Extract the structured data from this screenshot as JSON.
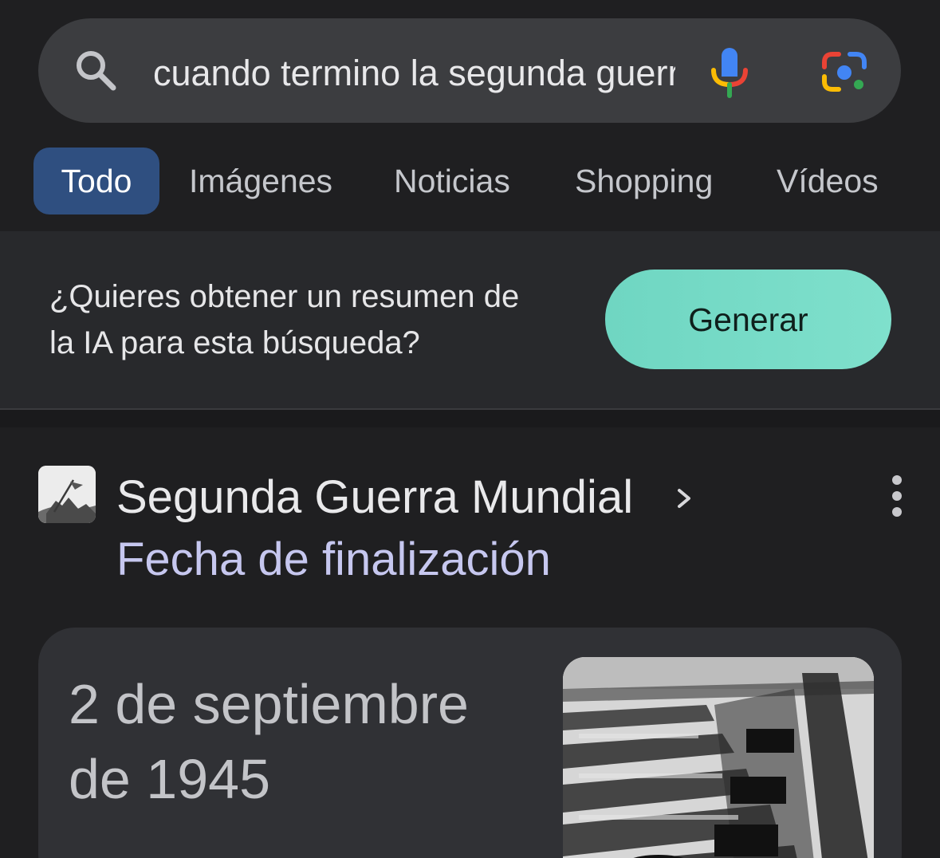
{
  "search": {
    "query": "cuando termino la segunda guerra mundial",
    "icons": {
      "search": "search-icon",
      "mic": "mic-icon",
      "lens": "google-lens-icon"
    }
  },
  "tabs": [
    {
      "label": "Todo",
      "active": true
    },
    {
      "label": "Imágenes",
      "active": false
    },
    {
      "label": "Noticias",
      "active": false
    },
    {
      "label": "Shopping",
      "active": false
    },
    {
      "label": "Vídeos",
      "active": false
    }
  ],
  "ai_prompt": {
    "line1": "¿Quieres obtener un resumen de",
    "line2": "la IA para esta búsqueda?",
    "button_label": "Generar"
  },
  "result": {
    "title": "Segunda Guerra Mundial",
    "subtitle": "Fecha de finalización",
    "answer_line1": "2 de septiembre",
    "answer_line2": "de 1945"
  },
  "colors": {
    "background": "#1f1f21",
    "search_bar": "#3c3d40",
    "active_tab": "#2f4f80",
    "generate_button": "#7fe0cc",
    "subtitle": "#c6c7ef",
    "card": "#303135"
  }
}
